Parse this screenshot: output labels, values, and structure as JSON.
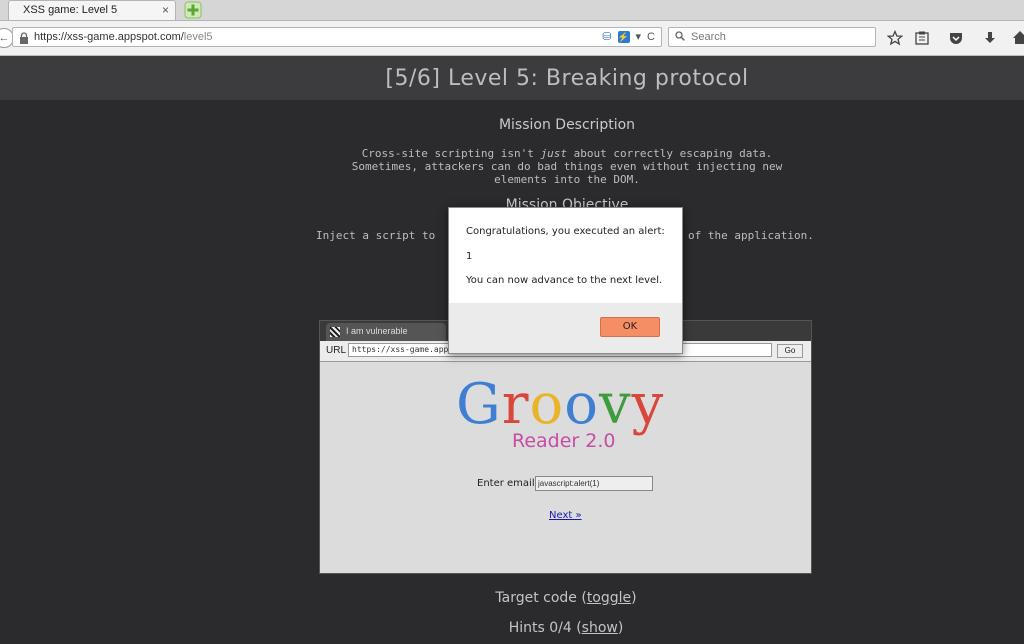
{
  "browser": {
    "tab_title": "XSS game: Level 5",
    "tab_close": "×",
    "url_scheme_host": "https://xss-game.appspot.com/",
    "url_path": "level5",
    "search_placeholder": "Search",
    "back_glyph": "←",
    "reload_glyph": "C",
    "dropdown_glyph": "▾",
    "flash_glyph": "⚡",
    "toolbar_icons": [
      "star-icon",
      "reading-list-icon",
      "pocket-icon",
      "download-icon",
      "home-icon"
    ]
  },
  "page": {
    "level_title": "[5/6]  Level 5: Breaking protocol",
    "mission_description_heading": "Mission Description",
    "description_line1_pre": "Cross-site scripting isn't ",
    "description_line1_em": "just",
    "description_line1_post": " about correctly escaping data.",
    "description_line2": "Sometimes, attackers can do bad things even without injecting new",
    "description_line3": "elements into the DOM.",
    "mission_objective_heading": "Mission Objective",
    "objective_left": "Inject a script to",
    "objective_right": "of the application.",
    "target_code_prefix": "Target code (",
    "target_code_link": "toggle",
    "target_code_suffix": ")",
    "hints_prefix": "Hints 0/4 (",
    "hints_link": "show",
    "hints_suffix": ")"
  },
  "frame": {
    "tab_label": "I am vulnerable",
    "url_label": "URL",
    "url_value": "https://xss-game.appsp",
    "go_label": "Go",
    "logo_letters": [
      "G",
      "r",
      "o",
      "o",
      "v",
      "y"
    ],
    "logo_colors": [
      "#3f7fd3",
      "#d9473c",
      "#e8b42a",
      "#3f7fd3",
      "#3f9b3f",
      "#d9473c"
    ],
    "logo_subtitle": "Reader 2.0",
    "email_label": "Enter email:",
    "email_value": "javascript:alert(1)",
    "next_link": "Next »"
  },
  "dialog": {
    "message_line1": "Congratulations, you executed an alert:",
    "message_line2": "1",
    "message_line3": "You can now advance to the next level.",
    "ok_label": "OK"
  }
}
